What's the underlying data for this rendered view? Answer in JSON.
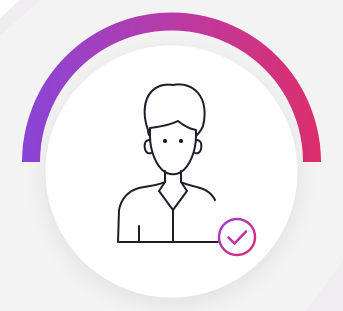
{
  "illustration": {
    "subject": "user-verified",
    "icons": [
      "user-icon",
      "check-circle-icon"
    ]
  },
  "colors": {
    "background": "#f4f3f4",
    "background_shadow": "#eceaed",
    "circle_fill": "#ffffff",
    "ring_gradient_start": "#8a45d6",
    "ring_gradient_mid": "#b93aa6",
    "ring_gradient_end": "#dd2e6c",
    "outline": "#1f1d2b",
    "badge_gradient_start": "#9b3fd2",
    "badge_gradient_end": "#dd2e6c"
  }
}
